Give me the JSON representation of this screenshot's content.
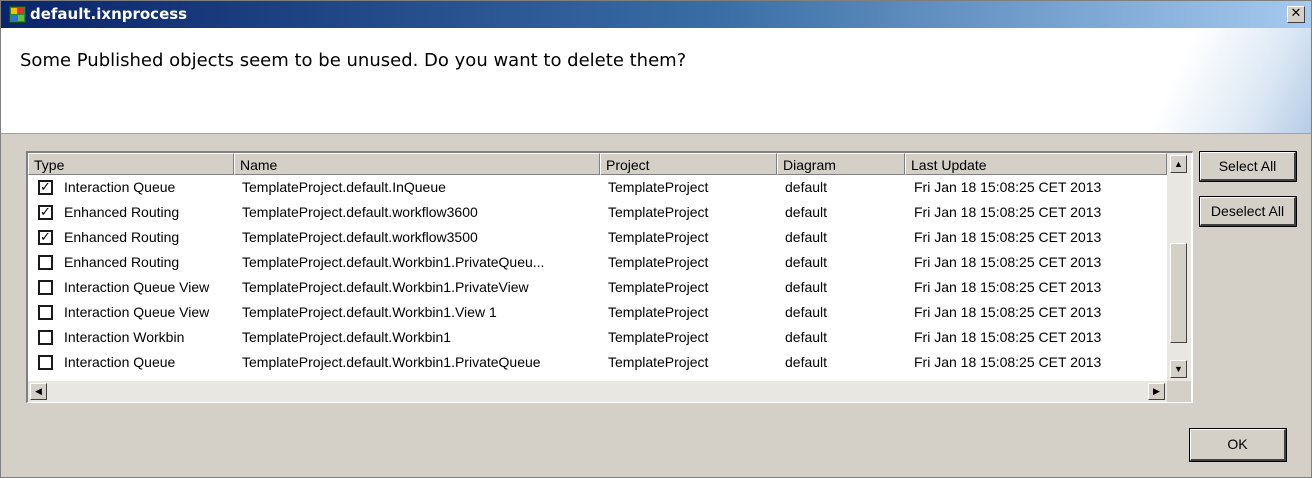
{
  "window": {
    "title": "default.ixnprocess",
    "close_glyph": "✕"
  },
  "banner": {
    "message": "Some Published objects seem to be unused. Do you want to delete them?"
  },
  "table": {
    "columns": [
      "Type",
      "Name",
      "Project",
      "Diagram",
      "Last Update"
    ],
    "rows": [
      {
        "checked": true,
        "type": "Interaction Queue",
        "name": "TemplateProject.default.InQueue",
        "project": "TemplateProject",
        "diagram": "default",
        "last_update": "Fri Jan 18 15:08:25 CET 2013"
      },
      {
        "checked": true,
        "type": "Enhanced Routing",
        "name": "TemplateProject.default.workflow3600",
        "project": "TemplateProject",
        "diagram": "default",
        "last_update": "Fri Jan 18 15:08:25 CET 2013"
      },
      {
        "checked": true,
        "type": "Enhanced Routing",
        "name": "TemplateProject.default.workflow3500",
        "project": "TemplateProject",
        "diagram": "default",
        "last_update": "Fri Jan 18 15:08:25 CET 2013"
      },
      {
        "checked": false,
        "type": "Enhanced Routing",
        "name": "TemplateProject.default.Workbin1.PrivateQueu...",
        "project": "TemplateProject",
        "diagram": "default",
        "last_update": "Fri Jan 18 15:08:25 CET 2013"
      },
      {
        "checked": false,
        "type": "Interaction Queue View",
        "name": "TemplateProject.default.Workbin1.PrivateView",
        "project": "TemplateProject",
        "diagram": "default",
        "last_update": "Fri Jan 18 15:08:25 CET 2013"
      },
      {
        "checked": false,
        "type": "Interaction Queue View",
        "name": "TemplateProject.default.Workbin1.View 1",
        "project": "TemplateProject",
        "diagram": "default",
        "last_update": "Fri Jan 18 15:08:25 CET 2013"
      },
      {
        "checked": false,
        "type": "Interaction Workbin",
        "name": "TemplateProject.default.Workbin1",
        "project": "TemplateProject",
        "diagram": "default",
        "last_update": "Fri Jan 18 15:08:25 CET 2013"
      },
      {
        "checked": false,
        "type": "Interaction Queue",
        "name": "TemplateProject.default.Workbin1.PrivateQueue",
        "project": "TemplateProject",
        "diagram": "default",
        "last_update": "Fri Jan 18 15:08:25 CET 2013"
      }
    ],
    "check_glyph": "✓"
  },
  "scroll": {
    "up_glyph": "▲",
    "down_glyph": "▼",
    "left_glyph": "◀",
    "right_glyph": "▶"
  },
  "buttons": {
    "select_all": "Select All",
    "deselect_all": "Deselect All",
    "ok": "OK"
  }
}
